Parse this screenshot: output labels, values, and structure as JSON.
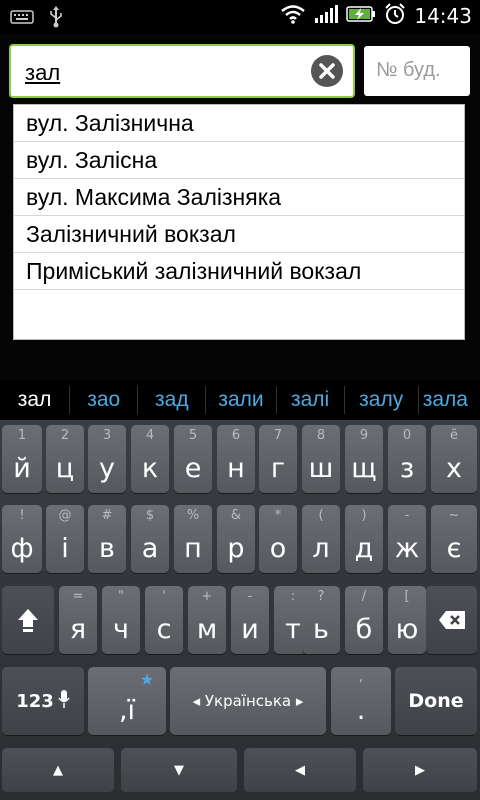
{
  "status_bar": {
    "time": "14:43",
    "icons": [
      "keyboard-icon",
      "usb-icon",
      "wifi-icon",
      "signal-icon",
      "battery-charging-icon",
      "alarm-icon"
    ]
  },
  "search": {
    "street_value": "зал",
    "house_placeholder": "№ буд."
  },
  "dropdown": {
    "items": [
      "вул. Залізнична",
      "вул. Залісна",
      "вул. Максима Залізняка",
      "Залізничний вокзал",
      "Приміський залізничний вокзал"
    ]
  },
  "suggestions": [
    "зал",
    "зао",
    "зад",
    "зали",
    "залі",
    "залу",
    "зала"
  ],
  "keyboard": {
    "row1": [
      {
        "main": "й",
        "hint": "1"
      },
      {
        "main": "ц",
        "hint": "2"
      },
      {
        "main": "у",
        "hint": "3"
      },
      {
        "main": "к",
        "hint": "4"
      },
      {
        "main": "е",
        "hint": "5"
      },
      {
        "main": "н",
        "hint": "6"
      },
      {
        "main": "г",
        "hint": "7"
      },
      {
        "main": "ш",
        "hint": "8"
      },
      {
        "main": "щ",
        "hint": "9"
      },
      {
        "main": "з",
        "hint": "0"
      },
      {
        "main": "х",
        "hint": "ё"
      }
    ],
    "row2": [
      {
        "main": "ф",
        "hint": "!"
      },
      {
        "main": "і",
        "hint": "@"
      },
      {
        "main": "в",
        "hint": "#"
      },
      {
        "main": "а",
        "hint": "$"
      },
      {
        "main": "п",
        "hint": "%"
      },
      {
        "main": "р",
        "hint": "&"
      },
      {
        "main": "о",
        "hint": "*"
      },
      {
        "main": "л",
        "hint": "("
      },
      {
        "main": "д",
        "hint": ")"
      },
      {
        "main": "ж",
        "hint": "-"
      },
      {
        "main": "є",
        "hint": "~"
      }
    ],
    "row3": [
      {
        "main": "я",
        "hint": "="
      },
      {
        "main": "ч",
        "hint": "\""
      },
      {
        "main": "с",
        "hint": "'"
      },
      {
        "main": "м",
        "hint": "+"
      },
      {
        "main": "и",
        "hint": "-"
      },
      {
        "main": "т",
        "hint": ":"
      },
      {
        "main": "ь",
        "hint": "?"
      },
      {
        "main": "б",
        "hint": "/"
      },
      {
        "main": "ю",
        "hint": "["
      }
    ],
    "num_key": "123",
    "comma_key": ",ї",
    "comma_hint": "★",
    "language_key": "◂ Українська ▸",
    "period_key": ".",
    "period_hint": ",",
    "done_key": "Done",
    "arrows": [
      "▲",
      "▼",
      "◀",
      "▶"
    ]
  },
  "colors": {
    "input_focus_border": "#8fcb3f",
    "suggestion_text": "#4fa8e0"
  }
}
